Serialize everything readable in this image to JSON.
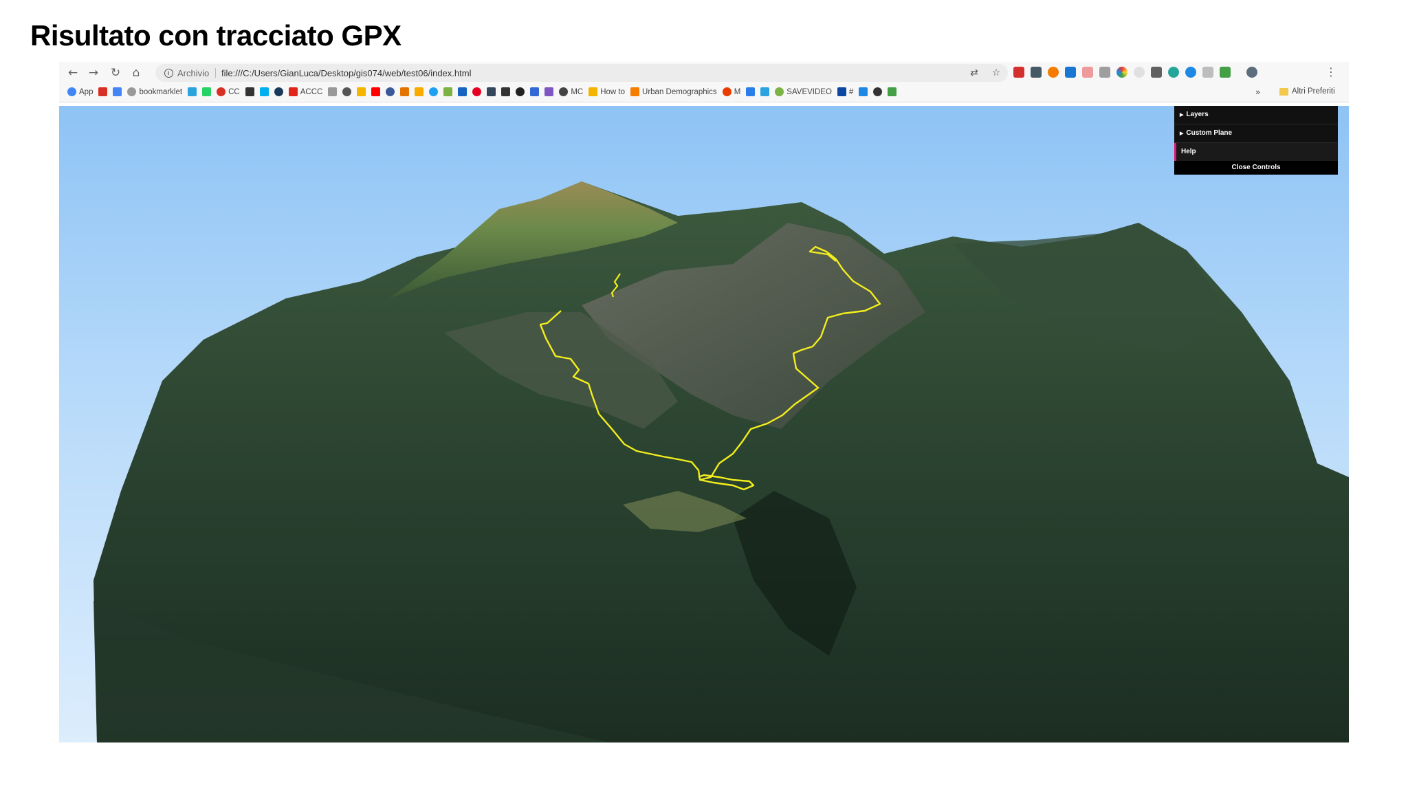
{
  "slide": {
    "title": "Risultato con tracciato GPX"
  },
  "browser": {
    "nav": {
      "back_icon": "←",
      "forward_icon": "→",
      "reload_icon": "↻",
      "home_icon": "⌂"
    },
    "address": {
      "label": "Archivio",
      "url": "file:///C:/Users/GianLuca/Desktop/gis074/web/test06/index.html"
    },
    "omnibox_icons": {
      "translate": "⇄",
      "star": "☆"
    },
    "menu_icon": "⋮",
    "bookmarks": [
      {
        "icon": "apps-grid-icon",
        "label": "App",
        "color": "#4285f4"
      },
      {
        "icon": "gmail-icon",
        "label": "",
        "color": "#d93025"
      },
      {
        "icon": "contacts-icon",
        "label": "",
        "color": "#4285f4"
      },
      {
        "icon": "page-icon",
        "label": "bookmarklet",
        "color": "#999999"
      },
      {
        "icon": "telegram-icon",
        "label": "",
        "color": "#2aa3df"
      },
      {
        "icon": "whatsapp-icon",
        "label": "",
        "color": "#25d366"
      },
      {
        "icon": "search-icon",
        "label": "CC",
        "color": "#d93025"
      },
      {
        "icon": "power-icon",
        "label": "",
        "color": "#333333"
      },
      {
        "icon": "skype-icon",
        "label": "",
        "color": "#00aff0"
      },
      {
        "icon": "pocket-icon",
        "label": "",
        "color": "#1a3a5c"
      },
      {
        "icon": "adobe-icon",
        "label": "ACCC",
        "color": "#e1251b"
      },
      {
        "icon": "page-icon",
        "label": "",
        "color": "#999999"
      },
      {
        "icon": "mushroom-icon",
        "label": "",
        "color": "#555555"
      },
      {
        "icon": "note-icon",
        "label": "",
        "color": "#f4b400"
      },
      {
        "icon": "youtube-icon",
        "label": "",
        "color": "#ff0000"
      },
      {
        "icon": "facebook-icon",
        "label": "",
        "color": "#3b5998"
      },
      {
        "icon": "maps-icon",
        "label": "",
        "color": "#e37400"
      },
      {
        "icon": "analytics-icon",
        "label": "",
        "color": "#f9ab00"
      },
      {
        "icon": "twitter-icon",
        "label": "",
        "color": "#1da1f2"
      },
      {
        "icon": "check-icon",
        "label": "",
        "color": "#7cb342"
      },
      {
        "icon": "bookmark-icon",
        "label": "",
        "color": "#1565c0"
      },
      {
        "icon": "pinterest-icon",
        "label": "",
        "color": "#e60023"
      },
      {
        "icon": "tumblr-icon",
        "label": "",
        "color": "#35465c"
      },
      {
        "icon": "hash-icon",
        "label": "",
        "color": "#333333"
      },
      {
        "icon": "h-icon",
        "label": "",
        "color": "#222222"
      },
      {
        "icon": "chat-icon",
        "label": "",
        "color": "#3367d6"
      },
      {
        "icon": "cube-icon",
        "label": "",
        "color": "#7e57c2"
      },
      {
        "icon": "bird-icon",
        "label": "MC",
        "color": "#444444"
      },
      {
        "icon": "howto-icon",
        "label": "How to",
        "color": "#f4b400"
      },
      {
        "icon": "blogger-icon",
        "label": "Urban Demographics",
        "color": "#f57d00"
      },
      {
        "icon": "office-icon",
        "label": "M",
        "color": "#eb3c00"
      },
      {
        "icon": "edit-icon",
        "label": "",
        "color": "#2b7de9"
      },
      {
        "icon": "telegram-icon",
        "label": "",
        "color": "#2aa3df"
      },
      {
        "icon": "android-icon",
        "label": "SAVEVIDEO",
        "color": "#7cb342"
      },
      {
        "icon": "qr-icon",
        "label": "#",
        "color": "#0d47a1"
      },
      {
        "icon": "code-icon",
        "label": "",
        "color": "#1e88e5"
      },
      {
        "icon": "c-icon",
        "label": "",
        "color": "#333333"
      },
      {
        "icon": "chat-bubble-icon",
        "label": "",
        "color": "#43a047"
      }
    ],
    "bookmarks_more": "»",
    "other_bookmarks": "Altri Preferiti"
  },
  "controls": {
    "items": [
      {
        "label": "Layers"
      },
      {
        "label": "Custom Plane"
      }
    ],
    "help_label": "Help",
    "close_label": "Close Controls"
  },
  "colors": {
    "gpx_track": "#f3ee1c",
    "controls_accent": "#e0186c"
  }
}
